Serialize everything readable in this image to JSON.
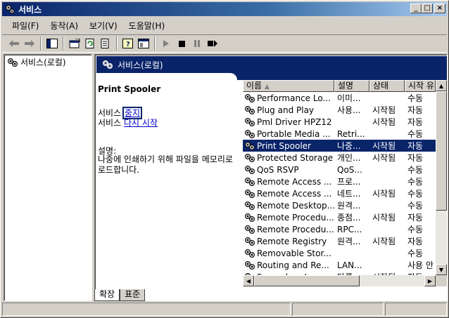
{
  "window": {
    "title": "서비스"
  },
  "menu": [
    {
      "label": "파일(F)"
    },
    {
      "label": "동작(A)"
    },
    {
      "label": "보기(V)"
    },
    {
      "label": "도움말(H)"
    }
  ],
  "tree": {
    "root_label": "서비스(로컬)"
  },
  "pane_header": {
    "title": "서비스(로컬)"
  },
  "details": {
    "service_name": "Print Spooler",
    "line1_prefix": "서비스 ",
    "stop_link": "중지",
    "line2_prefix": "서비스 ",
    "restart_link": "다시 시작",
    "description_label": "설명:",
    "description_text": "나중에 인쇄하기 위해 파일을 메모리로 로드합니다."
  },
  "list": {
    "columns": [
      "이름",
      "설명",
      "상태",
      "시작 유"
    ],
    "rows": [
      {
        "name": "Performance Lo...",
        "desc": "이미...",
        "status": "",
        "startup": "수동"
      },
      {
        "name": "Plug and Play",
        "desc": "사용...",
        "status": "시작됨",
        "startup": "자동"
      },
      {
        "name": "Pml Driver HPZ12",
        "desc": "",
        "status": "시작됨",
        "startup": "자동"
      },
      {
        "name": "Portable Media ...",
        "desc": "Retri...",
        "status": "",
        "startup": "수동"
      },
      {
        "name": "Print Spooler",
        "desc": "나중...",
        "status": "시작됨",
        "startup": "자동",
        "selected": true
      },
      {
        "name": "Protected Storage",
        "desc": "개인...",
        "status": "시작됨",
        "startup": "자동"
      },
      {
        "name": "QoS RSVP",
        "desc": "QoS...",
        "status": "",
        "startup": "수동"
      },
      {
        "name": "Remote Access ...",
        "desc": "프로...",
        "status": "",
        "startup": "수동"
      },
      {
        "name": "Remote Access ...",
        "desc": "네트...",
        "status": "시작됨",
        "startup": "수동"
      },
      {
        "name": "Remote Desktop...",
        "desc": "원격...",
        "status": "",
        "startup": "수동"
      },
      {
        "name": "Remote Procedu...",
        "desc": "종점...",
        "status": "시작됨",
        "startup": "자동"
      },
      {
        "name": "Remote Procedu...",
        "desc": "RPC...",
        "status": "",
        "startup": "수동"
      },
      {
        "name": "Remote Registry",
        "desc": "원격...",
        "status": "시작됨",
        "startup": "자동"
      },
      {
        "name": "Removable Stor...",
        "desc": "",
        "status": "",
        "startup": "수동"
      },
      {
        "name": "Routing and Re...",
        "desc": "LAN...",
        "status": "",
        "startup": "사용 안"
      },
      {
        "name": "Secondary Logon",
        "desc": "다른...",
        "status": "시작됨",
        "startup": "자동"
      }
    ]
  },
  "tabs": [
    {
      "label": "확장"
    },
    {
      "label": "표준"
    }
  ],
  "colors": {
    "titlebar": "#0a246a",
    "selection": "#0a246a",
    "link": "#0000cc"
  }
}
